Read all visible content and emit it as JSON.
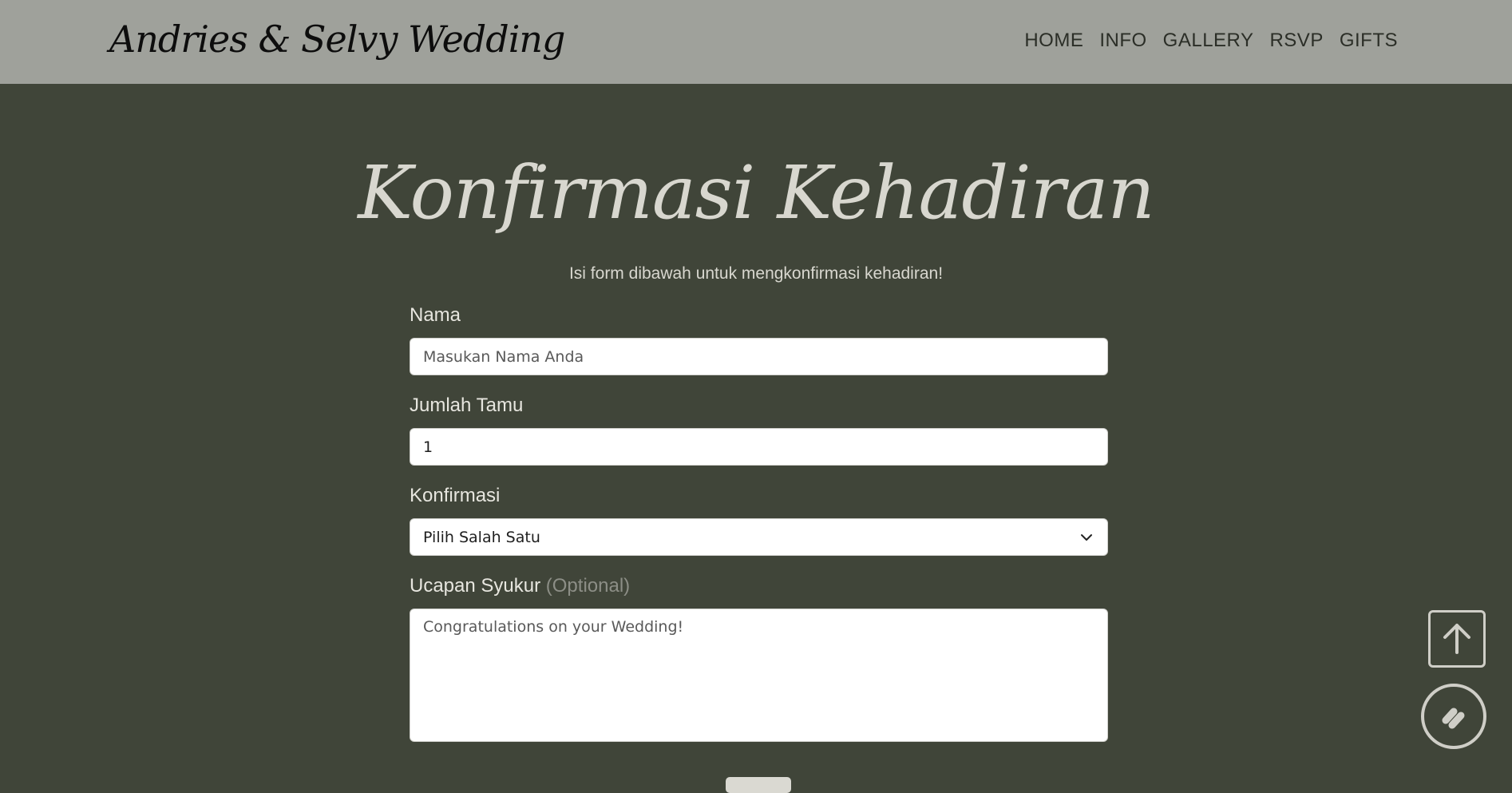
{
  "header": {
    "brand": "Andries & Selvy Wedding",
    "nav": [
      "HOME",
      "INFO",
      "GALLERY",
      "RSVP",
      "GIFTS"
    ]
  },
  "rsvp": {
    "title": "Konfirmasi Kehadiran",
    "subtitle": "Isi form dibawah untuk mengkonfirmasi kehadiran!",
    "name_label": "Nama",
    "name_placeholder": "Masukan Nama Anda",
    "guests_label": "Jumlah Tamu",
    "guests_value": "1",
    "confirm_label": "Konfirmasi",
    "confirm_selected": "Pilih Salah Satu",
    "message_label": "Ucapan Syukur",
    "message_optional": "(Optional)",
    "message_placeholder": "Congratulations on your Wedding!"
  },
  "icons": {
    "scroll_top": "arrow-up-icon",
    "music": "music-note-icon",
    "select": "chevron-down-icon"
  },
  "colors": {
    "navbar_bg": "#9fa19b",
    "page_bg": "#404539",
    "title_text": "#d8d7cf"
  }
}
